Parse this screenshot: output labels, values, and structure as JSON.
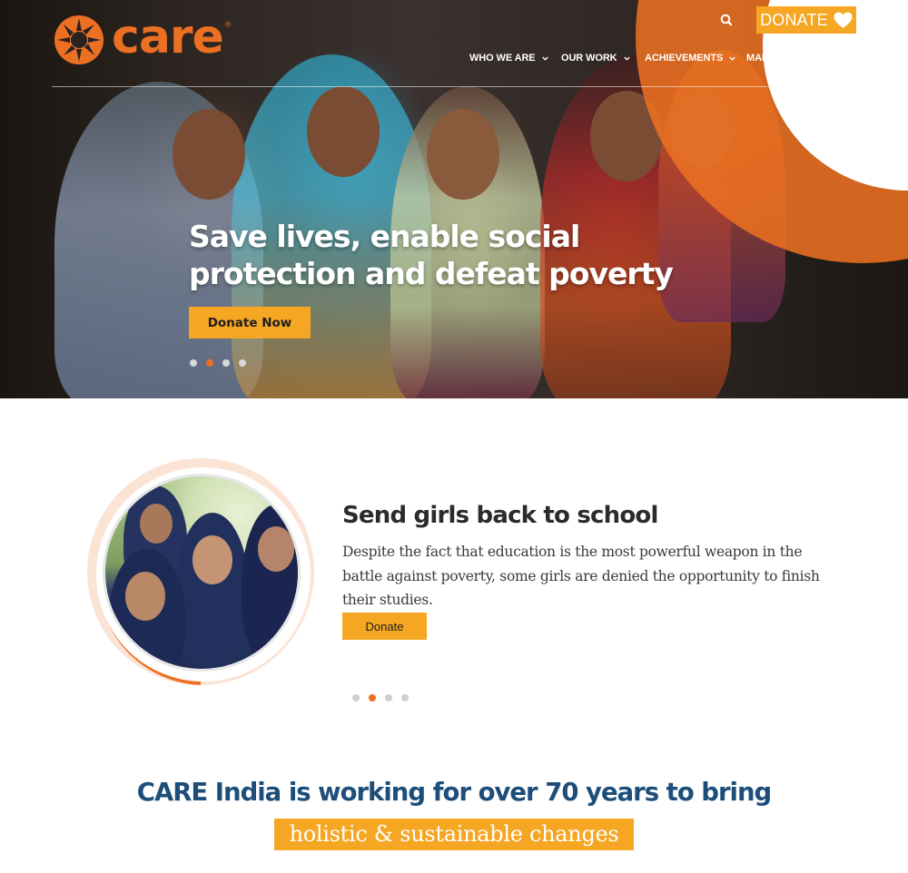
{
  "brand": {
    "name": "care",
    "registered": "®",
    "accent": "#ec7024",
    "button": "#f5a623",
    "navy": "#1d4e7a"
  },
  "header": {
    "search_icon": "search-icon",
    "donate_label": "DONATE",
    "donate_icon": "heart-icon",
    "nav": [
      {
        "label": "WHO WE ARE"
      },
      {
        "label": "OUR WORK"
      },
      {
        "label": "ACHIEVEMENTS"
      },
      {
        "label": "MAKE A DIFFERENCE"
      }
    ]
  },
  "hero": {
    "title": "Save lives, enable social protection and defeat poverty",
    "cta_label": "Donate Now",
    "dots_count": 4,
    "active_dot": 2
  },
  "slide": {
    "title": "Send girls back to school",
    "text": "Despite the fact that education is the most powerful weapon in the battle against poverty, some girls are denied the opportunity to finish their studies.",
    "cta_label": "Donate",
    "dots_count": 4,
    "active_dot": 2
  },
  "tagline": {
    "line1": "CARE India is working for over 70 years to bring",
    "highlight": "holistic & sustainable changes"
  }
}
